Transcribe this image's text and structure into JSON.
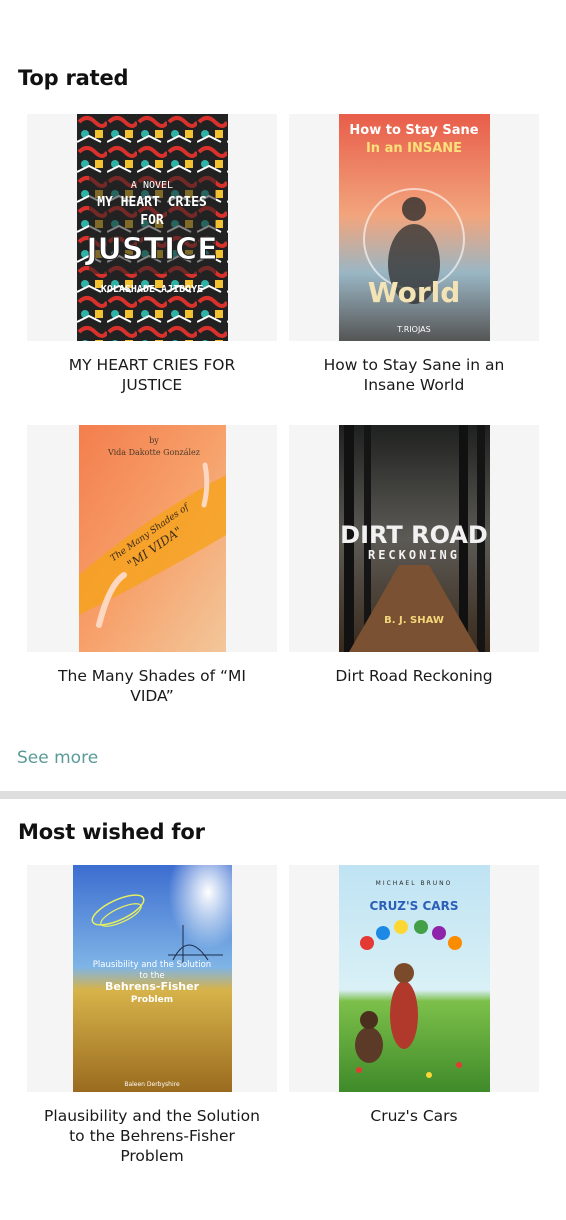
{
  "top_rated": {
    "title": "Top rated",
    "see_more": "See more",
    "books": [
      {
        "title": "MY HEART CRIES FOR JUSTICE",
        "cover_text": [
          "A NOVEL",
          "MY HEART CRIES",
          "FOR",
          "JUSTICE",
          "KOLASHADE AJIBOYE"
        ]
      },
      {
        "title": "How to Stay Sane in an Insane World",
        "cover_text": [
          "How to Stay Sane",
          "In an INSANE",
          "World",
          "T.RIOJAS"
        ]
      },
      {
        "title": "The Many Shades of “MI VIDA”",
        "cover_text": [
          "by",
          "Vida Dakotte González",
          "The Many Shades of",
          "\"MI VIDA\""
        ]
      },
      {
        "title": "Dirt Road Reckoning",
        "cover_text": [
          "DIRT ROAD",
          "RECKONING",
          "B. J. SHAW"
        ]
      }
    ]
  },
  "most_wished": {
    "title": "Most wished for",
    "books": [
      {
        "title": "Plausibility and the Solution to the Behrens-Fisher Problem",
        "cover_text": [
          "Plausibility and the Solution",
          "to the",
          "Behrens-Fisher",
          "Problem",
          "Baleen Derbyshire"
        ]
      },
      {
        "title": "Cruz's Cars",
        "cover_text": [
          "MICHAEL BRUNO",
          "CRUZ'S CARS"
        ]
      }
    ]
  },
  "colors": {
    "accent": "#5b9a99",
    "divider": "#dedede",
    "card_bg": "#f5f5f5"
  }
}
